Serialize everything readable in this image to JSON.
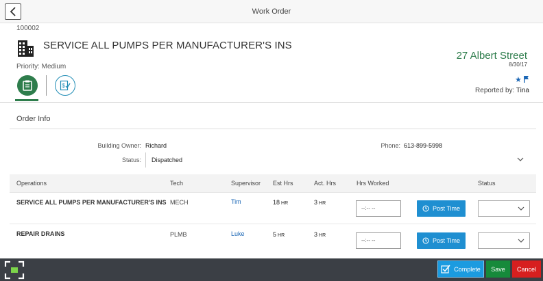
{
  "header": {
    "title": "Work Order",
    "back_icon": "chevron-left-icon"
  },
  "order": {
    "id": "100002",
    "title": "SERVICE ALL PUMPS PER MANUFACTURER'S INS",
    "priority": "Priority: Medium",
    "address": "27 Albert Street",
    "date": "8/30/17",
    "reported_label": "Reported by:",
    "reported_by": "Tina"
  },
  "tabs": [
    {
      "name": "order-info",
      "icon": "clipboard-icon",
      "active": true
    },
    {
      "name": "costs",
      "icon": "invoice-check-icon",
      "active": false
    }
  ],
  "section": {
    "title": "Order Info",
    "building_owner_label": "Building Owner:",
    "building_owner": "Richard",
    "phone_label": "Phone:",
    "phone": "613-899-5998",
    "status_label": "Status:",
    "status_value": "Dispatched"
  },
  "table": {
    "columns": [
      "Operations",
      "Tech",
      "Supervisor",
      "Est Hrs",
      "Act. Hrs",
      "Hrs Worked",
      "Status"
    ],
    "rows": [
      {
        "operation": "SERVICE ALL PUMPS PER MANUFACTURER'S INS",
        "tech": "MECH",
        "supervisor": "Tim",
        "est": "18",
        "act": "3",
        "unit": "HR",
        "hrs_worked": "--:-- --",
        "post_label": "Post Time",
        "status": ""
      },
      {
        "operation": "REPAIR DRAINS",
        "tech": "PLMB",
        "supervisor": "Luke",
        "est": "5",
        "act": "3",
        "unit": "HR",
        "hrs_worked": "--:-- --",
        "post_label": "Post Time",
        "status": ""
      }
    ]
  },
  "footer": {
    "complete_label": "Complete",
    "save_label": "Save",
    "cancel_label": "Cancel"
  },
  "colors": {
    "accent_green": "#2e7d4c",
    "link_blue": "#1a66b5",
    "post_blue": "#1f8fd1",
    "complete_blue": "#1b9be0",
    "save_green": "#168a3b",
    "cancel_red": "#d71f1f",
    "footer_bg": "#3b3f45"
  }
}
